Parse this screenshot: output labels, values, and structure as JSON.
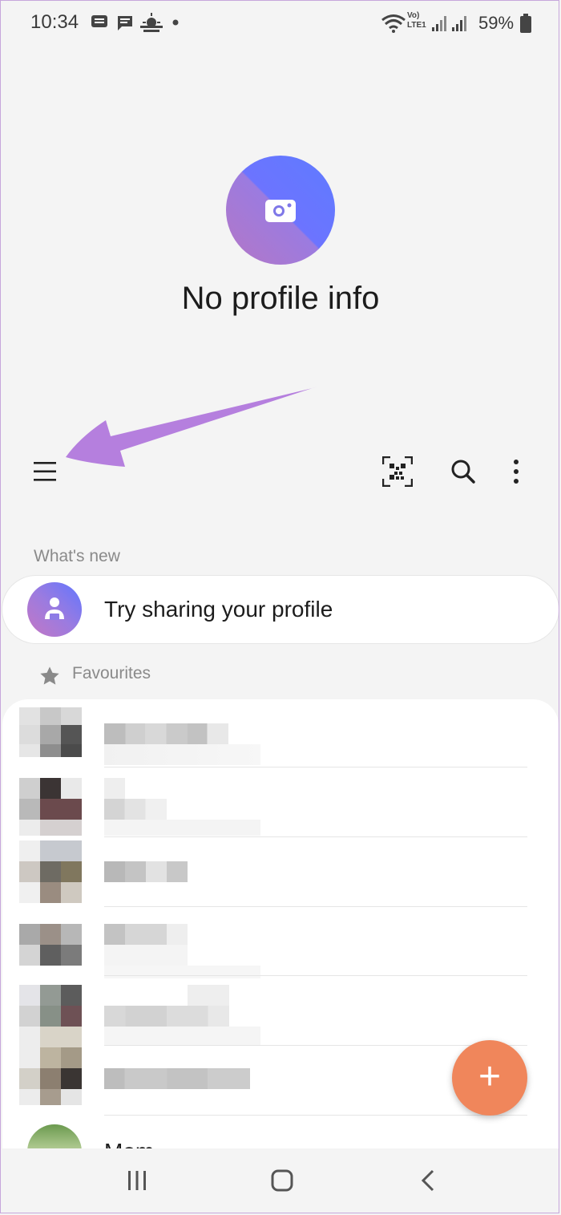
{
  "status_bar": {
    "time": "10:34",
    "network_label": "Vo) LTE1",
    "battery": "59%"
  },
  "profile": {
    "status_text": "No profile info"
  },
  "toolbar": {
    "menu_icon": "hamburger-menu-icon",
    "qr_icon": "qr-code-icon",
    "search_icon": "search-icon",
    "more_icon": "more-vertical-icon"
  },
  "whats_new": {
    "header": "What's new",
    "card_text": "Try sharing your profile"
  },
  "favourites": {
    "header": "Favourites",
    "contacts_blurred": 6,
    "last_contact_partial": "Mom"
  },
  "fab": {
    "label": "+"
  },
  "colors": {
    "background": "#f4f4f4",
    "accent_fab": "#f0865b",
    "arrow_annotation": "#b57fde",
    "avatar_blue": "#6076ff",
    "avatar_purple": "#b477c6"
  }
}
